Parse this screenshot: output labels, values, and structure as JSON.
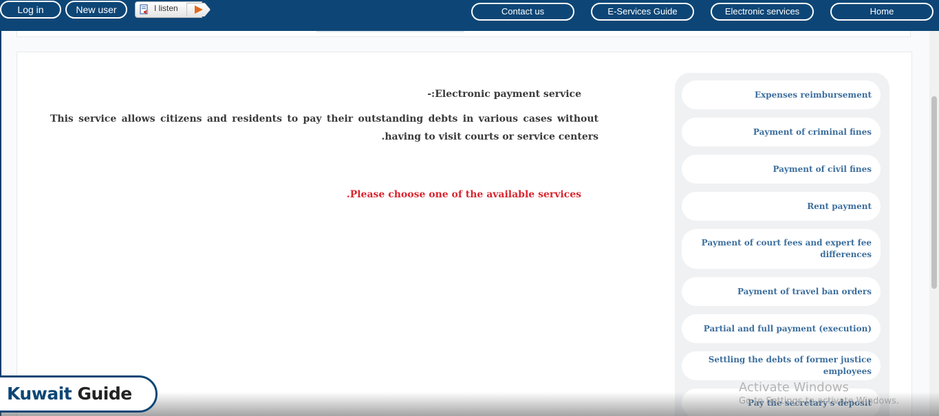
{
  "topbar": {
    "login": "Log in",
    "new_user": "New user",
    "listen": "I listen",
    "contact": "Contact us",
    "guide": "E-Services Guide",
    "electronic": "Electronic services",
    "home": "Home"
  },
  "content": {
    "title": "Electronic payment service:-",
    "description": "This service allows citizens and residents to pay their outstanding debts in various cases without having to visit courts or service centers.",
    "note": "Please choose one of the available services."
  },
  "services": [
    "Expenses reimbursement",
    "Payment of criminal fines",
    "Payment of civil fines",
    "Rent payment",
    "Payment of court fees and expert fee differences",
    "Payment of travel ban orders",
    "Partial and full payment (execution)",
    "Settling the debts of former justice employees",
    "Pay the secretary's deposit"
  ],
  "watermark": {
    "line1": "Activate Windows",
    "line2": "Go to Settings to activate Windows."
  },
  "logo": {
    "part1": "Kuwait",
    "part2": "Guide"
  },
  "colors": {
    "nav": "#0d4676",
    "link": "#3d6f9e",
    "alert": "#d9252e"
  },
  "icons": {
    "listen": "speaker-document-icon",
    "play": "play-icon"
  }
}
